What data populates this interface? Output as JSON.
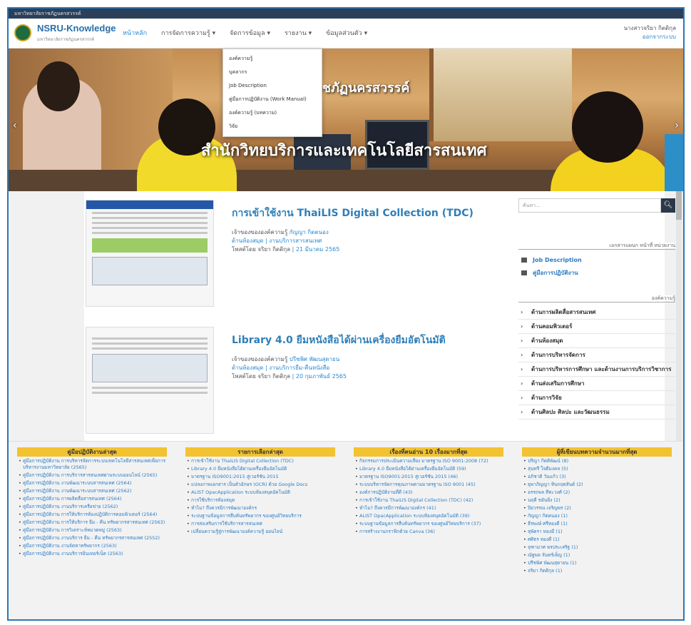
{
  "topbar": {
    "text": "มหาวิทยาลัยราชภัฏนครสวรรค์"
  },
  "header": {
    "brand": "NSRU-Knowledge",
    "brand_sub": "มหาวิทยาลัยราชภัฏนครสวรรค์",
    "nav": [
      {
        "label": "หน้าหลัก",
        "active": true
      },
      {
        "label": "การจัดการความรู้ ▾",
        "active": false
      },
      {
        "label": "จัดการข้อมูล ▾",
        "active": false
      },
      {
        "label": "รายงาน ▾",
        "active": false
      },
      {
        "label": "ข้อมูลส่วนตัว ▾",
        "active": false
      }
    ],
    "user_name": "นางสาวจริยา กิตติกุล",
    "user_link": "ออกจากระบบ"
  },
  "dropdown": {
    "items": [
      "องค์ความรู้",
      "บุคลากร",
      "Job Description",
      "คู่มือการปฏิบัติงาน (Work Manual)",
      "องค์ความรู้ (บทความ)",
      "วิจัย"
    ]
  },
  "hero": {
    "title_top": "ราชภัฏนครสวรรค์",
    "title_bottom": "สำนักวิทยบริการและเทคโนโลยีสารสนเทศ",
    "prev": "‹",
    "next": "›"
  },
  "posts": [
    {
      "title": "การเข้าใช้งาน ThaiLIS Digital Collection (TDC)",
      "meta_owner_label": "เจ้าของขององค์ความรู้",
      "meta_owner": "กัญญา กิตตนอง",
      "meta_dept": "ด้านห้องสมุด | งานบริการสารสนเทศ",
      "meta_post_label": "โพสต์โดย",
      "meta_poster": "จริยา กิตติกุล",
      "meta_date": "| 21 มีนาคม 2565"
    },
    {
      "title": "Library 4.0 ยืมหนังสือได้ผ่านเครื่องยืมอัตโนมัติ",
      "meta_owner_label": "เจ้าของขององค์ความรู้",
      "meta_owner": "ปรีชพิศ พัฒนสุดายน",
      "meta_dept": "ด้านห้องสมุด | งานบริการยืม-คืนหนังสือ",
      "meta_post_label": "โพสต์โดย",
      "meta_poster": "จริยา กิตติกุล",
      "meta_date": "| 20 กุมภาพันธ์ 2565"
    }
  ],
  "sidebar": {
    "search_placeholder": "ค้นหา...",
    "search_icon": "search-icon",
    "docs_title": "เอกสารแผนก หน้าที่ หน่วยงาน",
    "docs": [
      "Job Description",
      "คู่มือการปฏิบัติงาน"
    ],
    "cats_title": "องค์ความรู้",
    "cats": [
      "ด้านการผลิตสื่อสารสนเทศ",
      "ด้านคอมพิวเตอร์",
      "ด้านห้องสมุด",
      "ด้านการบริหารจัดการ",
      "ด้านการบริหารการศึกษา และด้านงานการบริการวิชาการ",
      "ด้านส่งเสริมการศึกษา",
      "ด้านการวิจัย",
      "ด้านศิลปะ ศิลปะ และวัฒนธรรม"
    ]
  },
  "footer": {
    "columns": [
      {
        "title": "คู่มือปฏิบัติงานล่าสุด",
        "items": [
          "คู่มือการปฏิบัติงาน การบริหารจัดการระบบเทคโนโลยีสารสนเทศเพื่อการบริหารงานมหาวิทยาลัย (2565)",
          "คู่มือการปฏิบัติงาน การบริการสารสนเทศผ่านระบบออนไลน์ (2565)",
          "คู่มือการปฏิบัติงาน งานพัฒนาระบบสารสนเทศ (2564)",
          "คู่มือการปฏิบัติงาน งานพัฒนาระบบสารสนเทศ (2562)",
          "คู่มือการปฏิบัติงาน การผลิตสื่อสารสนเทศ (2564)",
          "คู่มือการปฏิบัติงาน งานบริการเครือข่าย (2562)",
          "คู่มือการปฏิบัติงาน การให้บริการห้องปฏิบัติการคอมพิวเตอร์ (2564)",
          "คู่มือการปฏิบัติงาน การให้บริการ ยืม - คืน ทรัพยากรสารสนเทศ (2563)",
          "คู่มือการปฏิบัติงาน การวิเคราะห์หมวดหมู่ (2563)",
          "คู่มือการปฏิบัติงาน งานบริการ ยืม - คืน ทรัพยากรสารสนเทศ (2552)",
          "คู่มือการปฏิบัติงาน งานจัดหาทรัพยากร (2563)",
          "คู่มือการปฏิบัติงาน งานบริการอินเทอร์เน็ต (2563)"
        ]
      },
      {
        "title": "รายการเลือกล่าสุด",
        "items": [
          "การเข้าใช้งาน ThaiLIS Digital Collection (TDC)",
          "Library 4.0 ยืมหนังสือได้ผ่านเครื่องยืมอัตโนมัติ",
          "มาตรฐาน ISO9001:2015 สู่เวอร์ชัน 2015",
          "แปลงภาพเอกสาร เป็นตัวอักษร (OCR) ด้วย Google Docs",
          "ALIST OpacApplication ระบบห้องสมุดอัตโนมัติ",
          "การใช้บริการห้องสมุด",
          "ทำไม? ถึงควรมีการพัฒนาองค์กร",
          "ระบบฐานข้อมูลการสืบค้นทรัพยากร ของศูนย์วิทยบริการ",
          "การส่งเสริมการใช้บริการสารสนเทศ",
          "เปลี่ยนความรู้สู่การพัฒนาองค์ความรู้ ออนไลน์"
        ]
      },
      {
        "title": "เรื่องที่คนอ่าน 10 เรื่องมากที่สุด",
        "items": [
          "กิจกรรมการประเมินความเสี่ยง มาตรฐาน ISO 9001:2008 (72)",
          "Library 4.0 ยืมหนังสือได้ผ่านเครื่องยืมอัตโนมัติ (59)",
          "มาตรฐาน ISO9001:2015 สู่เวอร์ชัน 2015 (46)",
          "ระบบบริหารจัดการคุณภาพตามมาตรฐาน ISO 9001 (45)",
          "องค์การปฏิบัติงานที่ดี (43)",
          "การเข้าใช้งาน ThaiLIS Digital Collection (TDC) (42)",
          "ทำไม? ถึงควรมีการพัฒนาองค์กร (41)",
          "ALIST OpacApplication ระบบห้องสมุดอัตโนมัติ (39)",
          "ระบบฐานข้อมูลการสืบค้นทรัพยากร ของศูนย์วิทยบริการ (37)",
          "การสร้างงานกราฟิกด้วย Canva (36)"
        ]
      },
      {
        "title": "ผู้ที่เขียนบทความจำนวนมากที่สุด",
        "items": [
          "ปริญา กิตติพัฒน์ (8)",
          "สุนทรี ใจดีมงคล (5)",
          "อภิชาติ วันแก้ว (3)",
          "ยุพาภิญญา ทินกฤตสันต์ (2)",
          "อรรถพล สีทะวงศ์ (2)",
          "นฤดี ขยันยิ่ง (2)",
          "ปิยวรรณ เจริญพร (2)",
          "กัญญา กิตตนอง (1)",
          "ธีรพงษ์ ศรีทองดี (1)",
          "สุพัตรา ทองมี (1)",
          "ศศิธร ทองดี (1)",
          "จุฑามาศ พรประเสริฐ (1)",
          "ณัฐพล จันทร์เพ็ญ (1)",
          "ปรีชพิศ พัฒนสุดายน (1)",
          "จริยา กิตติกุล (1)"
        ]
      }
    ]
  }
}
